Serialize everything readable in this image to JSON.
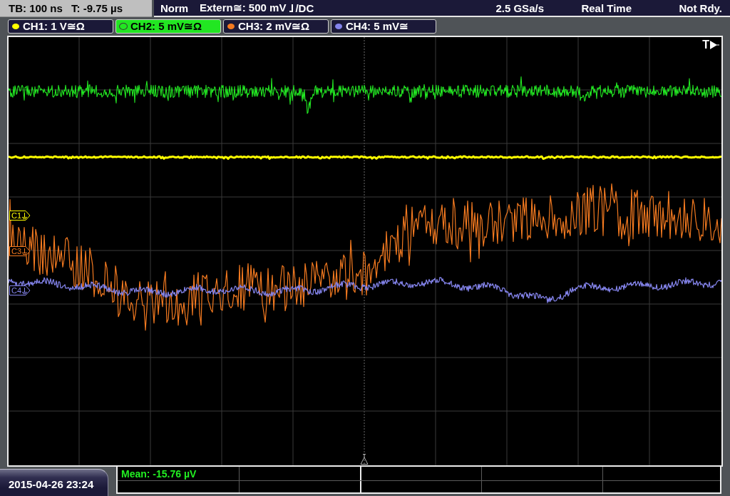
{
  "status_bar": {
    "timebase": "TB: 100 ns",
    "trigger_time": "T: -9.75 µs",
    "trigger_mode": "Norm",
    "trigger_source": "Extern≅: 500 mV",
    "trigger_coupling": "/DC",
    "sample_rate": "2.5 GSa/s",
    "acquisition_mode": "Real Time",
    "status": "Not Rdy."
  },
  "channels": [
    {
      "label": "CH1: 1 V≅Ω",
      "color": "#ffff00",
      "selected": false,
      "marker": "C1"
    },
    {
      "label": "CH2: 5 mV≅Ω",
      "color": "#22e622",
      "selected": true
    },
    {
      "label": "CH3: 2 mV≅Ω",
      "color": "#f47a20",
      "selected": false,
      "marker": "C3"
    },
    {
      "label": "CH4: 5 mV≅",
      "color": "#8484ec",
      "selected": false,
      "marker": "C4"
    }
  ],
  "display": {
    "trigger_marker": "T"
  },
  "measurements": {
    "cells": [
      "Mean: -15.76 µV"
    ]
  },
  "date_time": "2015-04-26 23:24"
}
